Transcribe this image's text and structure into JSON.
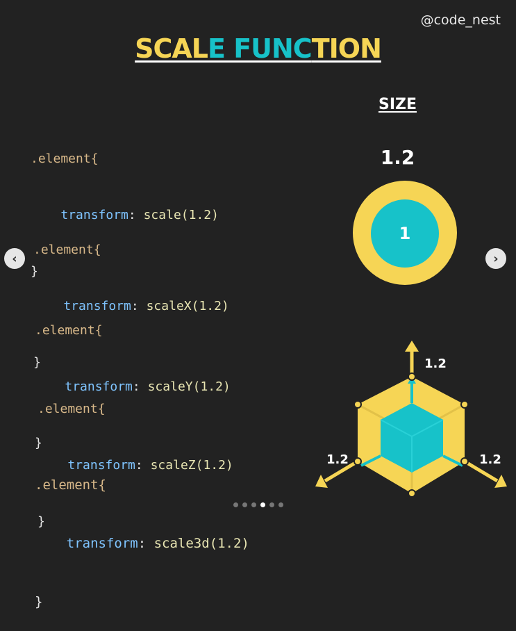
{
  "handle": "@code_nest",
  "title": {
    "part1": "SCAL",
    "part2": "E FUNC",
    "part3": "TION"
  },
  "colors": {
    "yellow": "#f6d555",
    "teal": "#17c2c9",
    "background": "#222222"
  },
  "code_blocks": [
    {
      "selector": ".element{",
      "property": "transform",
      "function": "scale(1.2)",
      "close": "}"
    },
    {
      "selector": ".element{",
      "property": "transform",
      "function": "scaleX(1.2)",
      "close": "}"
    },
    {
      "selector": ".element{",
      "property": "transform",
      "function": "scaleY(1.2)",
      "close": "}"
    },
    {
      "selector": ".element{",
      "property": "transform",
      "function": "scaleZ(1.2)",
      "close": "}"
    },
    {
      "selector": ".element{",
      "property": "transform",
      "function": "scale3d(1.2)",
      "close": "}"
    }
  ],
  "size_demo": {
    "label": "SIZE",
    "scaled_value": "1.2",
    "original_value": "1"
  },
  "axes": {
    "top": "1.2",
    "left": "1.2",
    "right": "1.2"
  },
  "nav": {
    "prev_icon": "chevron-left-icon",
    "next_icon": "chevron-right-icon"
  },
  "carousel": {
    "total": 6,
    "active": 4
  }
}
